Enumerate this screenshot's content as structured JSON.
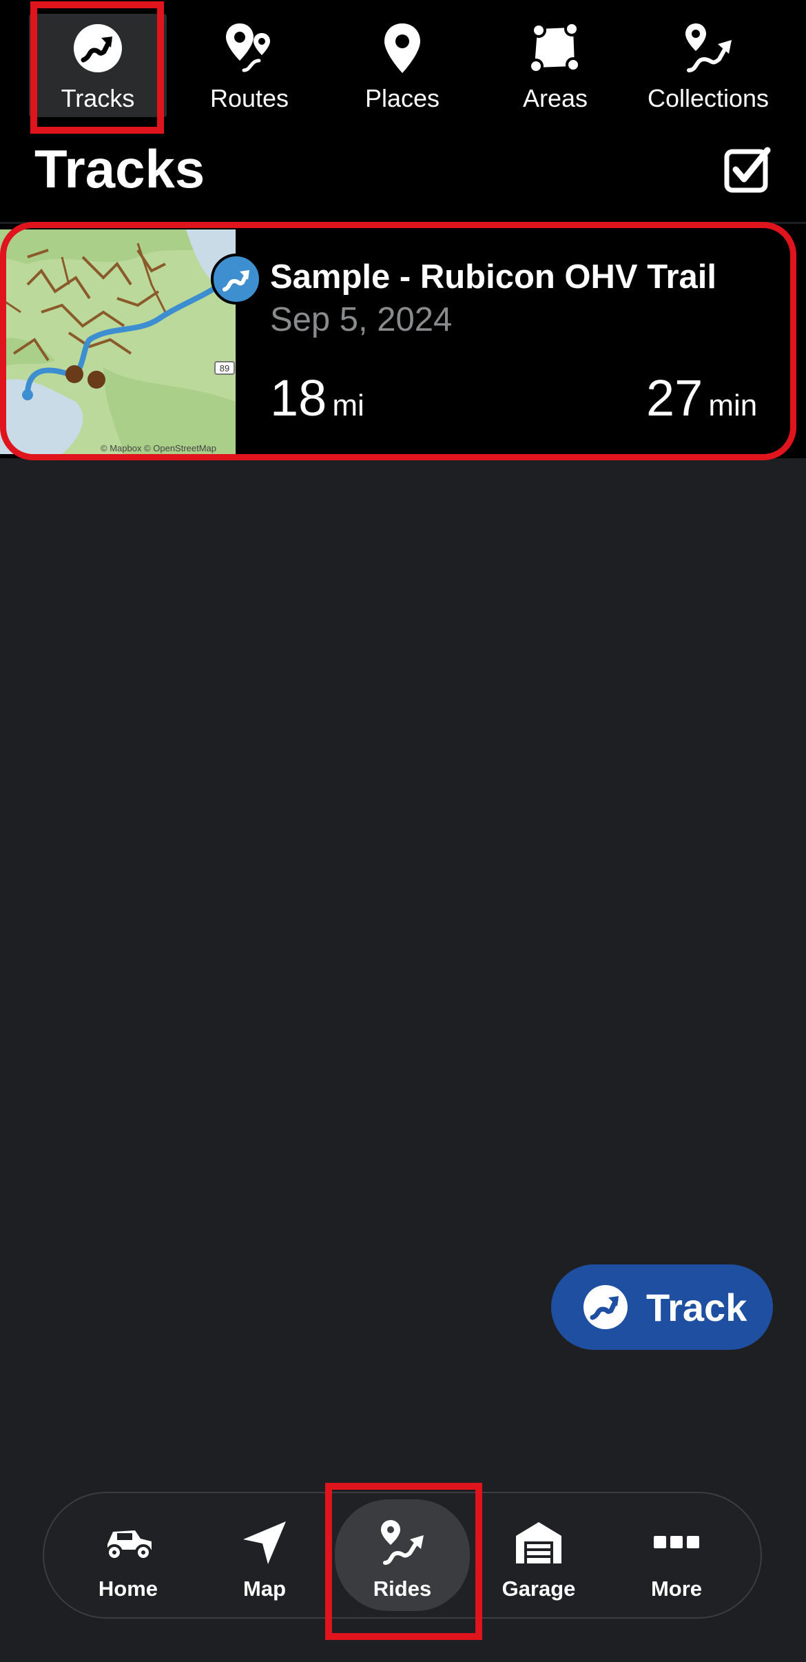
{
  "top_tabs": [
    {
      "label": "Tracks",
      "icon": "track-arrow-icon",
      "active": true
    },
    {
      "label": "Routes",
      "icon": "route-pins-icon",
      "active": false
    },
    {
      "label": "Places",
      "icon": "map-pin-icon",
      "active": false
    },
    {
      "label": "Areas",
      "icon": "area-polygon-icon",
      "active": false
    },
    {
      "label": "Collections",
      "icon": "collection-route-icon",
      "active": false
    }
  ],
  "header": {
    "title": "Tracks",
    "select_icon": "checkbox-checked-icon"
  },
  "tracks": [
    {
      "title": "Sample - Rubicon OHV Trail",
      "date": "Sep 5, 2024",
      "distance_value": "18",
      "distance_unit": "mi",
      "duration_value": "27",
      "duration_unit": "min",
      "map_attribution": "© Mapbox © OpenStreetMap",
      "map_road_label": "89"
    }
  ],
  "fab": {
    "label": "Track",
    "icon": "track-arrow-icon"
  },
  "bottom_nav": [
    {
      "label": "Home",
      "icon": "utv-vehicle-icon",
      "active": false
    },
    {
      "label": "Map",
      "icon": "navigation-arrow-icon",
      "active": false
    },
    {
      "label": "Rides",
      "icon": "rides-route-icon",
      "active": true
    },
    {
      "label": "Garage",
      "icon": "garage-icon",
      "active": false
    },
    {
      "label": "More",
      "icon": "more-dots-icon",
      "active": false
    }
  ],
  "colors": {
    "background": "#1d1f22",
    "highlight": "#e0141c",
    "accent_blue": "#3e8fd0",
    "fab_blue": "#1f4fa0",
    "date_gray": "#8a8b8d"
  }
}
